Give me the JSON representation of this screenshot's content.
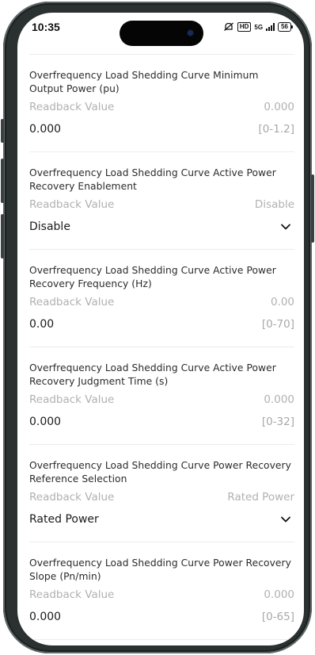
{
  "status_bar": {
    "time": "10:35",
    "hd": "HD",
    "network": "5G",
    "battery": "56"
  },
  "readback_label": "Readback Value",
  "items": [
    {
      "title": "Overfrequency Load Shedding Curve Minimum Output Power (pu)",
      "readback": "0.000",
      "value": "0.000",
      "range": "[0-1.2]"
    },
    {
      "title": "Overfrequency Load Shedding Curve Active Power Recovery Enablement",
      "readback": "Disable",
      "value": "Disable",
      "control": "dropdown",
      "icon": "chevron-down-icon"
    },
    {
      "title": "Overfrequency Load Shedding Curve Active Power Recovery Frequency (Hz)",
      "readback": "0.00",
      "value": "0.00",
      "range": "[0-70]"
    },
    {
      "title": "Overfrequency Load Shedding Curve Active Power Recovery Judgment Time (s)",
      "readback": "0.000",
      "value": "0.000",
      "range": "[0-32]"
    },
    {
      "title": "Overfrequency Load Shedding Curve Power Recovery Reference Selection",
      "readback": "Rated Power",
      "value": "Rated Power",
      "control": "dropdown",
      "icon": "chevron-down-icon"
    },
    {
      "title": "Overfrequency Load Shedding Curve Power Recovery Slope (Pn/min)",
      "readback": "0.000",
      "value": "0.000",
      "range": "[0-65]"
    }
  ]
}
